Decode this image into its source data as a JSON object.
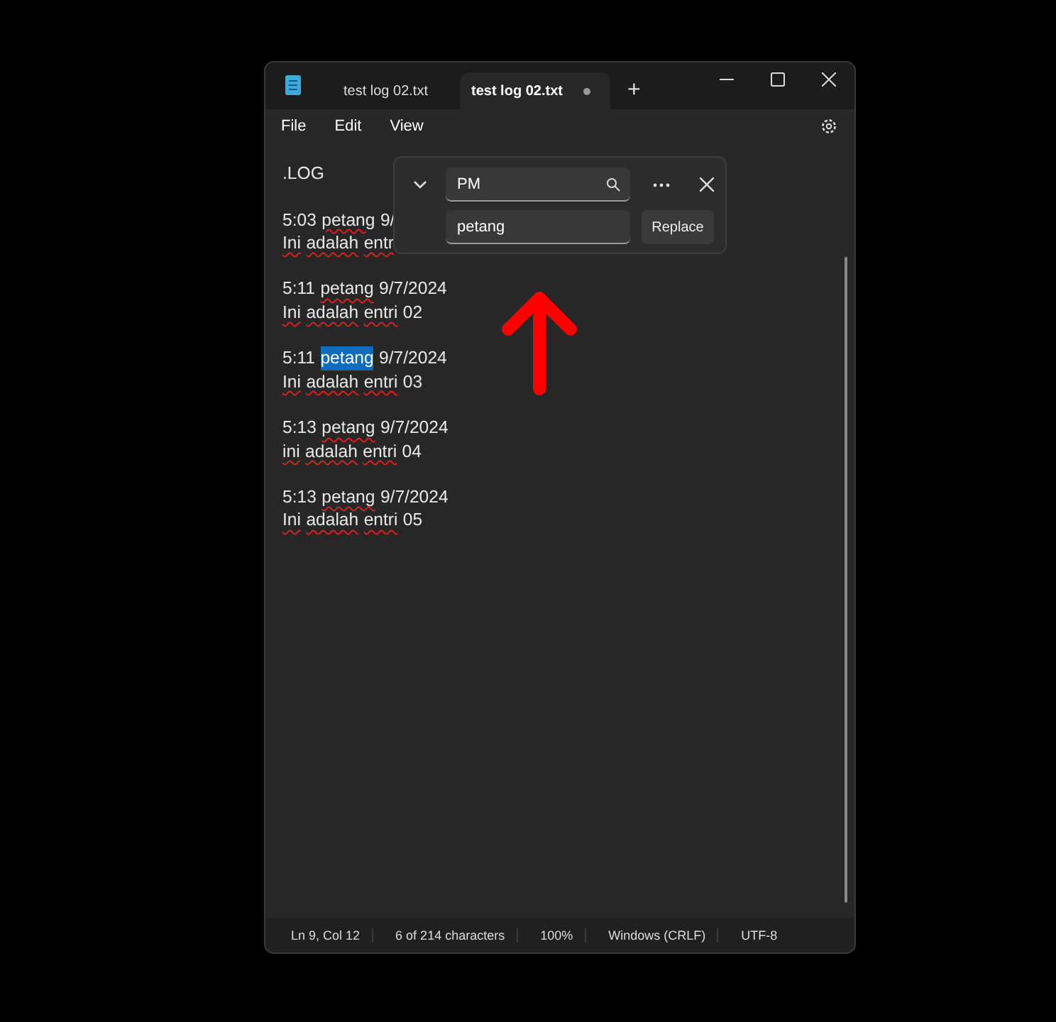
{
  "tabs": [
    {
      "label": "test log 02.txt",
      "selected": false,
      "unsaved": false
    },
    {
      "label": "test log 02.txt",
      "selected": true,
      "unsaved": true
    }
  ],
  "add_tab": "+",
  "menu": [
    "File",
    "Edit",
    "View"
  ],
  "editor_paragraphs": [
    {
      "lines": [
        {
          "words": [
            {
              "text": ".LOG",
              "misspelled": false,
              "selected": false
            }
          ]
        }
      ]
    },
    {
      "lines": [
        {
          "words": [
            {
              "text": "5:03",
              "misspelled": false,
              "selected": false
            },
            {
              "text": "petang",
              "misspelled": true,
              "selected": false
            },
            {
              "text": "9/",
              "misspelled": false,
              "selected": false
            }
          ]
        },
        {
          "words": [
            {
              "text": "Ini",
              "misspelled": true,
              "selected": false
            },
            {
              "text": "adalah",
              "misspelled": true,
              "selected": false
            },
            {
              "text": "entr",
              "misspelled": true,
              "selected": false
            }
          ]
        }
      ]
    },
    {
      "lines": [
        {
          "words": [
            {
              "text": "5:11",
              "misspelled": false,
              "selected": false
            },
            {
              "text": "petang",
              "misspelled": true,
              "selected": false
            },
            {
              "text": "9/7/2024",
              "misspelled": false,
              "selected": false
            }
          ]
        },
        {
          "words": [
            {
              "text": "Ini",
              "misspelled": true,
              "selected": false
            },
            {
              "text": "adalah",
              "misspelled": true,
              "selected": false
            },
            {
              "text": "entri",
              "misspelled": true,
              "selected": false
            },
            {
              "text": "02",
              "misspelled": false,
              "selected": false
            }
          ]
        }
      ]
    },
    {
      "lines": [
        {
          "words": [
            {
              "text": "5:11",
              "misspelled": false,
              "selected": false
            },
            {
              "text": "petang",
              "misspelled": false,
              "selected": true
            },
            {
              "text": "9/7/2024",
              "misspelled": false,
              "selected": false
            }
          ]
        },
        {
          "words": [
            {
              "text": "Ini",
              "misspelled": true,
              "selected": false
            },
            {
              "text": "adalah",
              "misspelled": true,
              "selected": false
            },
            {
              "text": "entri",
              "misspelled": true,
              "selected": false
            },
            {
              "text": "03",
              "misspelled": false,
              "selected": false
            }
          ]
        }
      ]
    },
    {
      "lines": [
        {
          "words": [
            {
              "text": "5:13",
              "misspelled": false,
              "selected": false
            },
            {
              "text": "petang",
              "misspelled": true,
              "selected": false
            },
            {
              "text": "9/7/2024",
              "misspelled": false,
              "selected": false
            }
          ]
        },
        {
          "words": [
            {
              "text": "ini",
              "misspelled": true,
              "selected": false
            },
            {
              "text": "adalah",
              "misspelled": true,
              "selected": false
            },
            {
              "text": "entri",
              "misspelled": true,
              "selected": false
            },
            {
              "text": "04",
              "misspelled": false,
              "selected": false
            }
          ]
        }
      ]
    },
    {
      "lines": [
        {
          "words": [
            {
              "text": "5:13",
              "misspelled": false,
              "selected": false
            },
            {
              "text": "petang",
              "misspelled": true,
              "selected": false
            },
            {
              "text": "9/7/2024",
              "misspelled": false,
              "selected": false
            }
          ]
        },
        {
          "words": [
            {
              "text": "Ini",
              "misspelled": true,
              "selected": false
            },
            {
              "text": "adalah",
              "misspelled": true,
              "selected": false
            },
            {
              "text": "entri",
              "misspelled": true,
              "selected": false
            },
            {
              "text": "05",
              "misspelled": false,
              "selected": false
            }
          ]
        }
      ]
    }
  ],
  "find_panel": {
    "find_value": "PM",
    "replace_value": "petang",
    "replace_button": "Replace"
  },
  "status_bar": [
    "Ln 9, Col 12",
    "6 of 214 characters",
    "100%",
    "Windows (CRLF)",
    "UTF-8"
  ]
}
